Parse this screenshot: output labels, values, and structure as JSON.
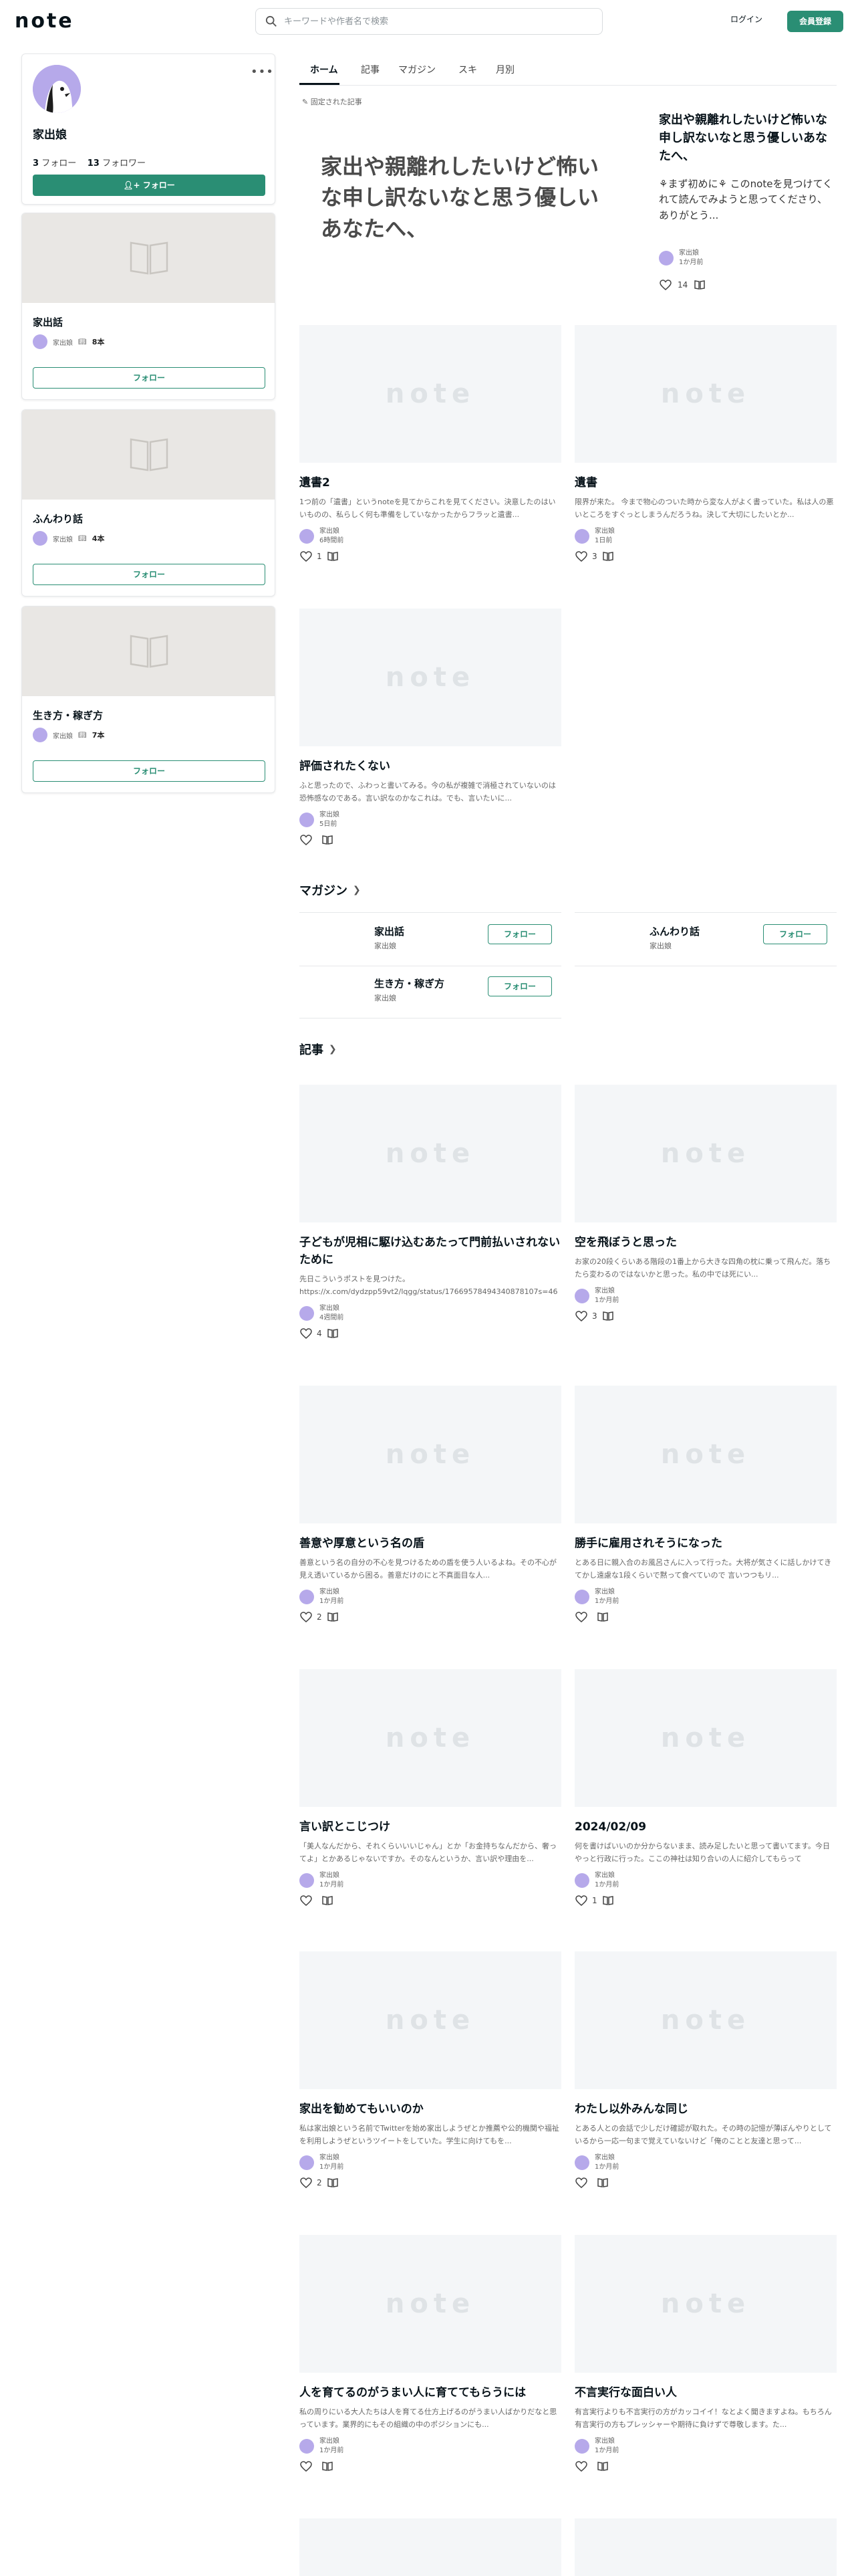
{
  "header": {
    "logo": "note",
    "search_placeholder": "キーワードや作者名で検索",
    "login_label": "ログイン",
    "signup_label": "会員登録"
  },
  "profile": {
    "name": "家出娘",
    "follow_count": "3",
    "follow_label": "フォロー",
    "follower_count": "13",
    "follower_label": "フォロワー",
    "follow_button": "フォロー",
    "menu_glyph": "•••"
  },
  "sidebar_magazines": [
    {
      "title": "家出話",
      "author": "家出娘",
      "count": "8本",
      "follow": "フォロー"
    },
    {
      "title": "ふんわり話",
      "author": "家出娘",
      "count": "4本",
      "follow": "フォロー"
    },
    {
      "title": "生き方・稼ぎ方",
      "author": "家出娘",
      "count": "7本",
      "follow": "フォロー"
    }
  ],
  "tabs": [
    "ホーム",
    "記事",
    "マガジン",
    "スキ",
    "月別"
  ],
  "pinned": {
    "label": "固定された記事",
    "thumb_text": "家出や親離れしたいけど怖い な申し訳ないなと思う優しい あなたへ、",
    "title": "家出や親離れしたいけど怖いな申し訳ないなと思う優しいあなたへ、",
    "excerpt": "⚘️まず初めに⚘️ このnoteを見つけてくれて読んでみようと思ってくださり、ありがとう...",
    "author": "家出娘",
    "time": "1か月前",
    "likes": "14"
  },
  "top_articles": [
    {
      "title": "遺書2",
      "excerpt": "1つ前の「遺書」というnoteを見てからこれを見てください。決意したのはいいものの、私らしく何も準備をしていなかったからフラッと遺書...",
      "author": "家出娘",
      "time": "6時間前",
      "likes": "1"
    },
    {
      "title": "遺書",
      "excerpt": "限界が来た。 今まで物心のついた時から変な人がよく書っていた。私は人の悪いところをすぐっとしまうんだろうね。決して大切にしたいとか...",
      "author": "家出娘",
      "time": "1日前",
      "likes": "3"
    },
    {
      "title": "評価されたくない",
      "excerpt": "ふと思ったので、ふわっと書いてみる。今の私が複雑で消極されていないのは恐怖感なのである。言い訳なのかなこれは。でも、言いたいに...",
      "author": "家出娘",
      "time": "5日前",
      "likes": ""
    }
  ],
  "magazine_section": {
    "heading": "マガジン",
    "items": [
      {
        "title": "家出話",
        "author": "家出娘",
        "follow": "フォロー"
      },
      {
        "title": "ふんわり話",
        "author": "家出娘",
        "follow": "フォロー"
      },
      {
        "title": "生き方・稼ぎ方",
        "author": "家出娘",
        "follow": "フォロー"
      }
    ]
  },
  "articles_section": {
    "heading": "記事",
    "items": [
      {
        "title": "子どもが児相に駆け込むあたって門前払いされないために",
        "excerpt": "先日こういうポストを見つけた。 https://x.com/dydzpp59vt2/lqgg/status/17669578494340878107s=46 ...",
        "author": "家出娘",
        "time": "4週間前",
        "likes": "4"
      },
      {
        "title": "空を飛ぼうと思った",
        "excerpt": "お家の20段くらいある階段の1番上から大きな四角の枕に乗って飛んだ。落ちたら変わるのではないかと思った。私の中では死にい...",
        "author": "家出娘",
        "time": "1か月前",
        "likes": "3"
      },
      {
        "title": "善意や厚意という名の盾",
        "excerpt": "善意という名の自分の不心を見つけるための盾を使う人いるよね。その不心が見え透いているから困る。善意だけのにと不真面目な人...",
        "author": "家出娘",
        "time": "1か月前",
        "likes": "2"
      },
      {
        "title": "勝手に雇用されそうになった",
        "excerpt": "とある日に親入合のお風呂さんに入って行った。大将が気さくに話しかけてきてかし遠慮な1段くらいで黙って食べていので 言いつつもリ...",
        "author": "家出娘",
        "time": "1か月前",
        "likes": ""
      },
      {
        "title": "言い訳とこじつけ",
        "excerpt": "「美人なんだから、それくらいいいじゃん」とか「お金持ちなんだから、奢ってよ」とかあるじゃないですか。そのなんというか、言い訳や理由を...",
        "author": "家出娘",
        "time": "1か月前",
        "likes": ""
      },
      {
        "title": "2024/02/09",
        "excerpt": "何を書けばいいのか分からないまま、読み足したいと思って書いてます。今日やっと行政に行った。ここの神社は知り合いの人に紹介してもらって2021/10/2...",
        "author": "家出娘",
        "time": "1か月前",
        "likes": "1"
      },
      {
        "title": "家出を勧めてもいいのか",
        "excerpt": "私は家出娘という名前でTwitterを始め家出しようぜとか推薦や公的機関や福祉を利用しようぜというツイートをしていた。学生に向けてもを...",
        "author": "家出娘",
        "time": "1か月前",
        "likes": "2"
      },
      {
        "title": "わたし以外みんな同じ",
        "excerpt": "とある人との会話で少しだけ確認が取れた。その時の記憶が薄ぼんやりとしているから一応一句まで覚えていないけど「俺のことと友達と思って...",
        "author": "家出娘",
        "time": "1か月前",
        "likes": ""
      },
      {
        "title": "人を育てるのがうまい人に育ててもらうには",
        "excerpt": "私の周りにいる大人たちは人を育てる仕方上げるのがうまい人ばかりだなと思っています。業界的にもその組織の中のポジションにも...",
        "author": "家出娘",
        "time": "1か月前",
        "likes": ""
      },
      {
        "title": "不言実行な面白い人",
        "excerpt": "有言実行よりも不言実行の方がカッコイイ！なとよく聞きますよね。もちろん有言実行の方もプレッシャーや期待に負けずで尊敬します。た...",
        "author": "家出娘",
        "time": "1か月前",
        "likes": ""
      }
    ]
  },
  "colors": {
    "brand_green": "#2a8e74",
    "avatar_purple": "#b6a9ea",
    "thumb_bg": "#f4f6f8"
  }
}
